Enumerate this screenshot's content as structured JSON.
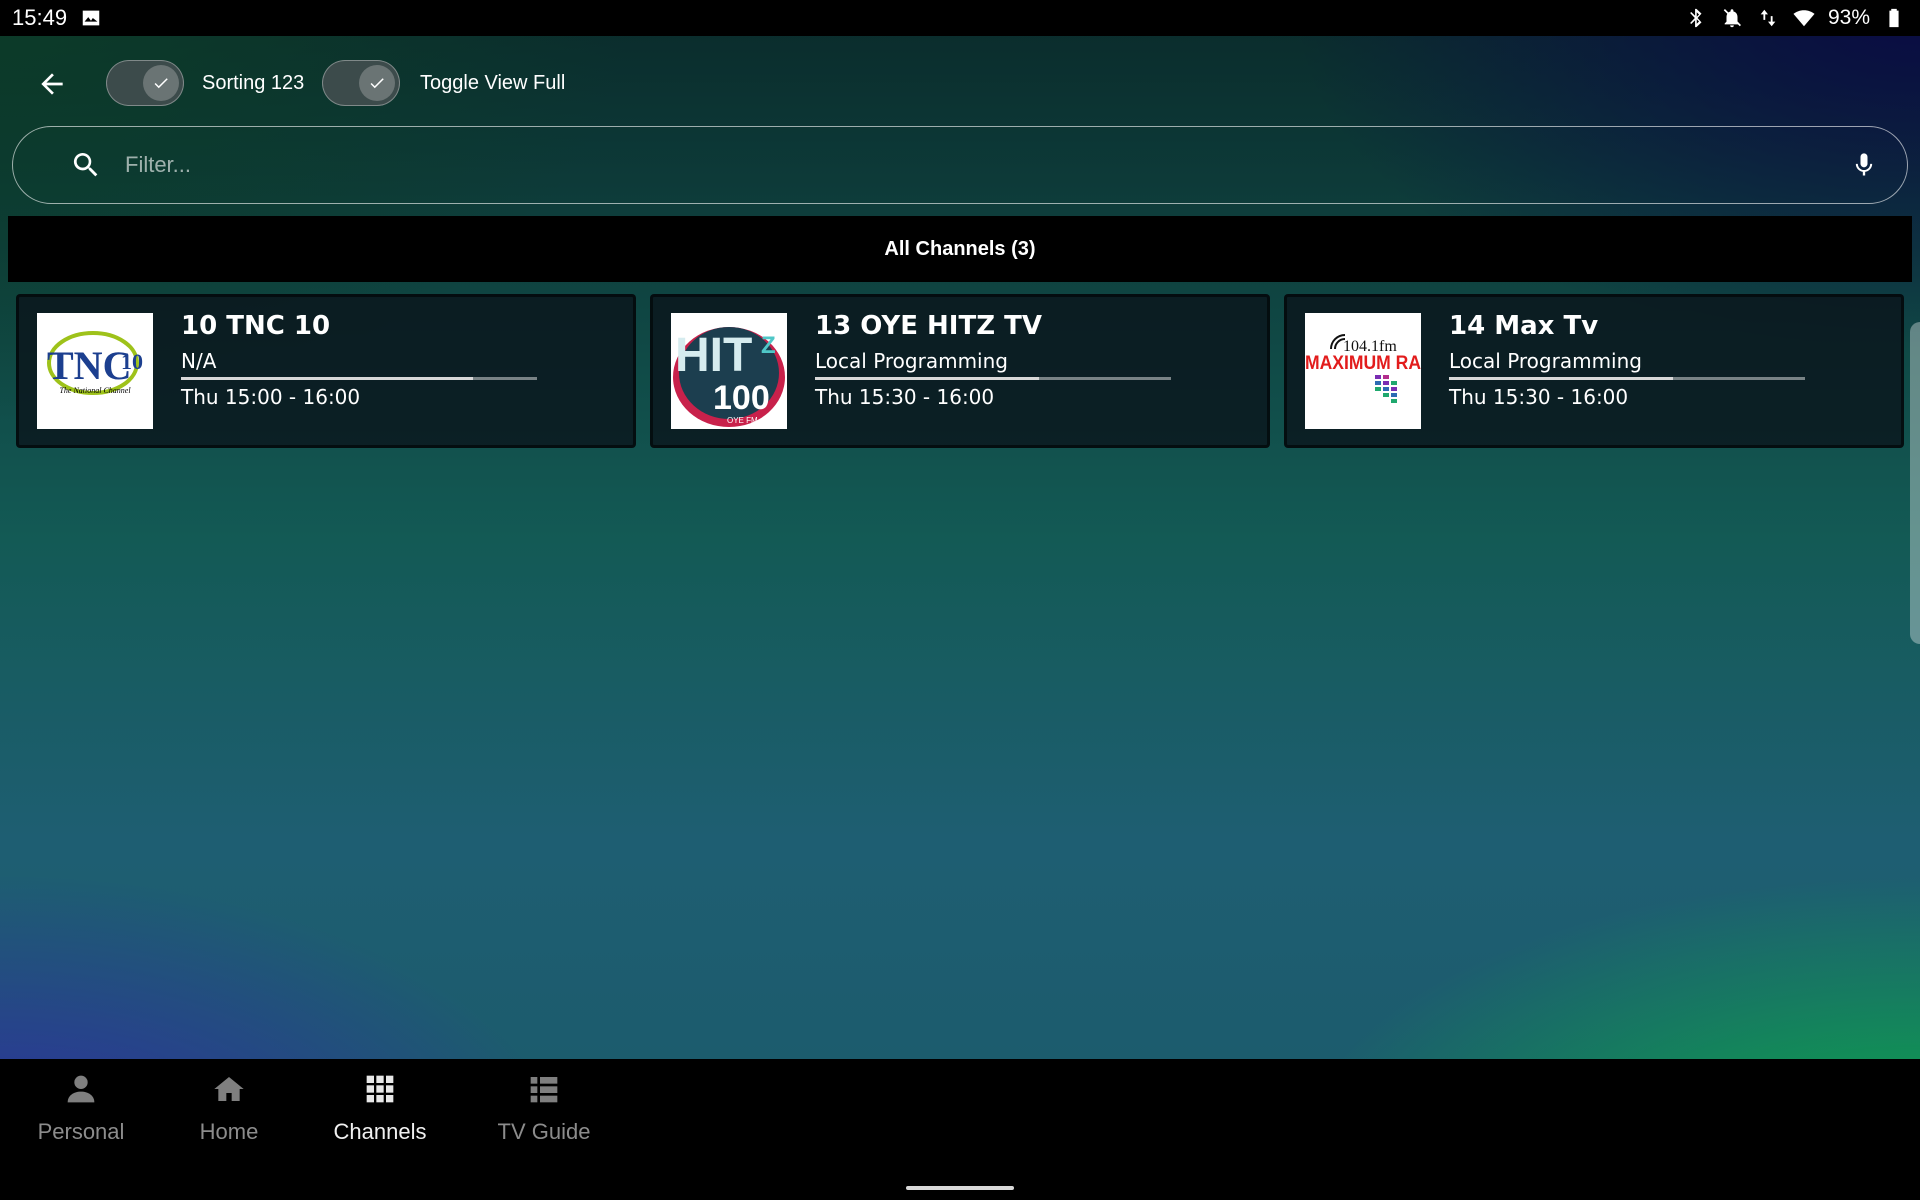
{
  "status_bar": {
    "time": "15:49",
    "battery_percent": "93%",
    "icons": [
      "image-icon",
      "bluetooth-icon",
      "notifications-off-icon",
      "data-arrows-icon",
      "wifi-icon",
      "battery-icon"
    ]
  },
  "toolbar": {
    "sorting_label": "Sorting 123",
    "sorting_on": true,
    "toggle_view_label": "Toggle View Full",
    "toggle_view_on": true
  },
  "search": {
    "placeholder": "Filter...",
    "value": ""
  },
  "section": {
    "title": "All Channels (3)"
  },
  "channels": [
    {
      "title": "10 TNC 10",
      "program": "N/A",
      "time": "Thu 15:00 - 16:00",
      "progress": 0.82,
      "logo": {
        "main": "TNC",
        "number": "10",
        "tagline": "The National Channel"
      }
    },
    {
      "title": "13 OYE HITZ TV",
      "program": "Local Programming",
      "time": "Thu 15:30 - 16:00",
      "progress": 0.63,
      "logo": {
        "main": "HIT",
        "sub": "Z",
        "number": "100",
        "tagline": "OYE FM"
      }
    },
    {
      "title": "14 Max Tv",
      "program": "Local Programming",
      "time": "Thu 15:30 - 16:00",
      "progress": 0.63,
      "logo": {
        "freq": "104.1fm",
        "main": "MAXIMUM RA"
      }
    }
  ],
  "bottom_nav": {
    "items": [
      {
        "label": "Personal",
        "icon": "person-icon",
        "active": false
      },
      {
        "label": "Home",
        "icon": "home-icon",
        "active": false
      },
      {
        "label": "Channels",
        "icon": "grid-icon",
        "active": true
      },
      {
        "label": "TV Guide",
        "icon": "list-icon",
        "active": false
      }
    ]
  },
  "colors": {
    "bar_background": "#000000",
    "active_nav": "#f0f0f0",
    "inactive_nav": "#8c8c8c",
    "bottom_right_glow": "#0ab446",
    "bottom_left_glow": "#3228aa"
  }
}
